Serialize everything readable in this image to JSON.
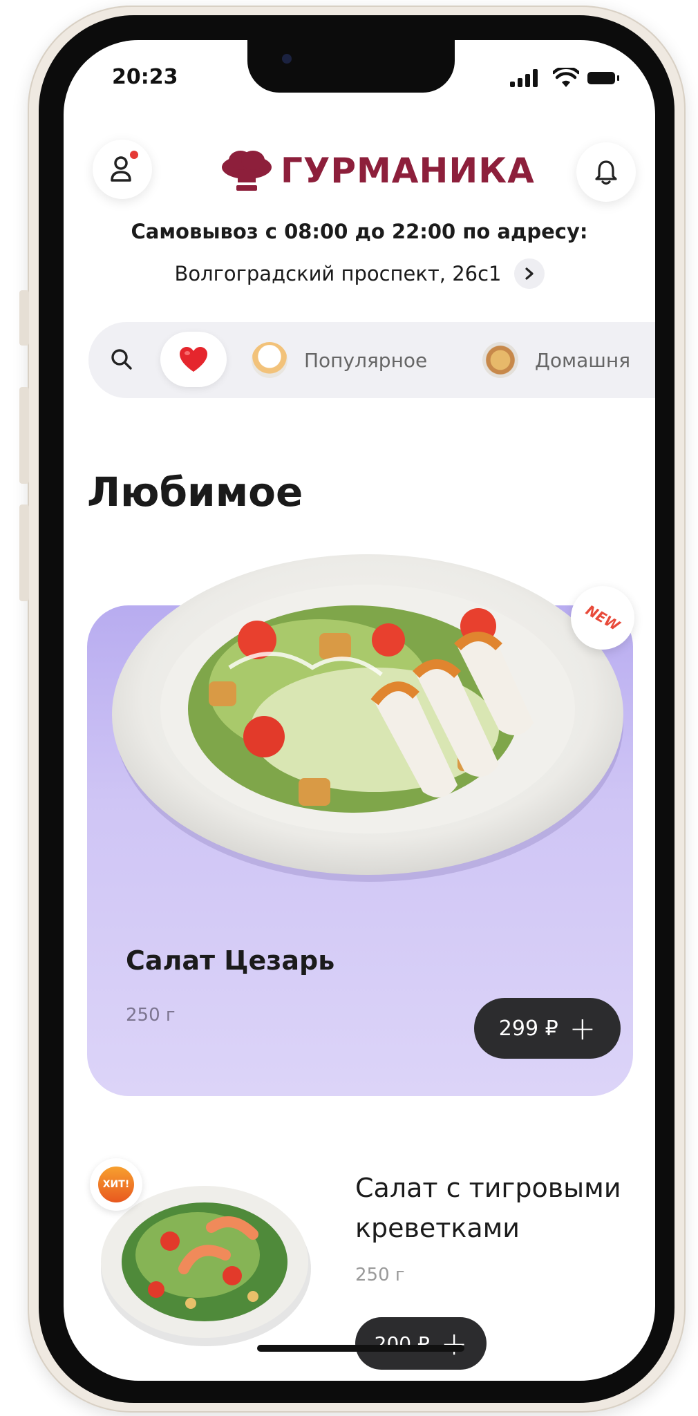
{
  "status_bar": {
    "time": "20:23"
  },
  "header": {
    "brand": "ГУРМАНИКА",
    "pickup_line": "Самовывоз с 08:00 до 22:00 по адресу:",
    "address": "Волгоградский проспект, 26с1"
  },
  "categories": {
    "items": [
      {
        "label": "Популярное"
      },
      {
        "label": "Домашня"
      }
    ]
  },
  "section": {
    "title": "Любимое"
  },
  "featured": {
    "name": "Салат Цезарь",
    "weight": "250 г",
    "price": "299 ₽",
    "badge": "NEW"
  },
  "list": [
    {
      "name": "Салат с тигровыми креветками",
      "weight": "250 г",
      "price": "200 ₽",
      "badge": "ХИТ!"
    }
  ],
  "colors": {
    "brand": "#8d1f3b",
    "card_bg": "#cfc5f5",
    "price_button": "#2c2c2e",
    "notification_dot": "#e53935"
  },
  "icons": [
    "profile-icon",
    "bell-icon",
    "search-icon",
    "heart-icon",
    "chevron-right-icon",
    "plus-icon",
    "chef-hat-icon"
  ]
}
